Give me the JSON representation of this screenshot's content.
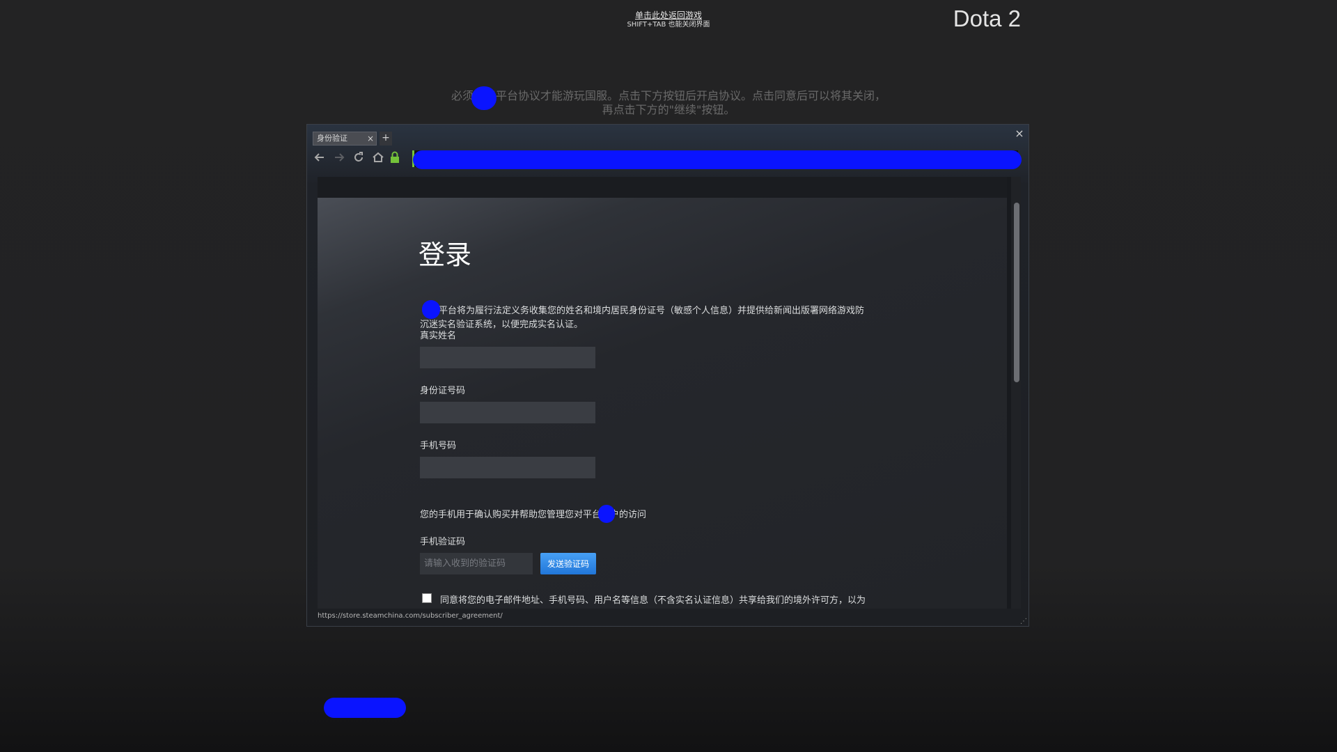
{
  "overlay": {
    "return_link": "单击此处返回游戏",
    "return_hint": "SHIFT+TAB 也能关闭界面",
    "game_title": "Dota 2",
    "notice_line1": "必须同意平台协议才能游玩国服。点击下方按钮后开启协议。点击同意后可以将其关闭，",
    "notice_line2": "再点击下方的\"继续\"按钮。"
  },
  "browser": {
    "tab_title": "身份验证",
    "tab_close": "×",
    "new_tab": "+",
    "window_close": "×",
    "url": "",
    "status_url": "https://store.steamchina.com/subscriber_agreement/",
    "icons": {
      "back": "back-arrow-icon",
      "forward": "forward-arrow-icon",
      "reload": "reload-icon",
      "home": "home-icon",
      "secure": "lock-icon"
    }
  },
  "page": {
    "title": "登录",
    "intro_line1": "平台将为履行法定义务收集您的姓名和境内居民身份证号（敏感个人信息）并提供给新闻出版署网络游戏防",
    "intro_line2": "沉迷实名验证系统，以便完成实名认证。",
    "real_name_label": "真实姓名",
    "real_name_value": "",
    "id_label": "身份证号码",
    "id_value": "",
    "phone_label": "手机号码",
    "phone_value": "",
    "phone_note": "您的手机用于确认购买并帮助您管理您对平台账户的访问",
    "code_label": "手机验证码",
    "code_placeholder": "请输入收到的验证码",
    "send_code_button": "发送验证码",
    "agree_text": "同意将您的电子邮件地址、手机号码、用户名等信息（不含实名认证信息）共享给我们的境外许可方，以为"
  },
  "colors": {
    "accent_button": "#2f86e6",
    "secure_green": "#74c23a",
    "redaction_blue": "#0a14ff"
  }
}
